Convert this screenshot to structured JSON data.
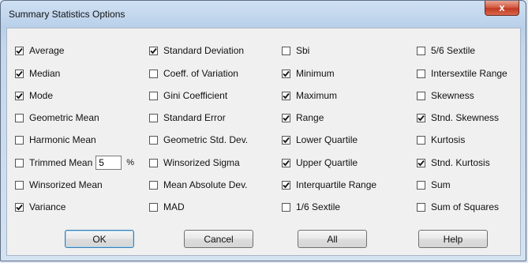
{
  "window": {
    "title": "Summary Statistics Options",
    "close_label": "x"
  },
  "options": {
    "col1": [
      {
        "label": "Average",
        "checked": true
      },
      {
        "label": "Median",
        "checked": true
      },
      {
        "label": "Mode",
        "checked": true
      },
      {
        "label": "Geometric Mean",
        "checked": false
      },
      {
        "label": "Harmonic Mean",
        "checked": false
      },
      {
        "label": "Trimmed Mean",
        "checked": false
      },
      {
        "label": "Winsorized Mean",
        "checked": false
      },
      {
        "label": "Variance",
        "checked": true
      }
    ],
    "col2": [
      {
        "label": "Standard Deviation",
        "checked": true
      },
      {
        "label": "Coeff. of Variation",
        "checked": false
      },
      {
        "label": "Gini Coefficient",
        "checked": false
      },
      {
        "label": "Standard Error",
        "checked": false
      },
      {
        "label": "Geometric Std. Dev.",
        "checked": false
      },
      {
        "label": "Winsorized Sigma",
        "checked": false
      },
      {
        "label": "Mean Absolute Dev.",
        "checked": false
      },
      {
        "label": "MAD",
        "checked": false
      }
    ],
    "col3": [
      {
        "label": "Sbi",
        "checked": false
      },
      {
        "label": "Minimum",
        "checked": true
      },
      {
        "label": "Maximum",
        "checked": true
      },
      {
        "label": "Range",
        "checked": true
      },
      {
        "label": "Lower Quartile",
        "checked": true
      },
      {
        "label": "Upper Quartile",
        "checked": true
      },
      {
        "label": "Interquartile Range",
        "checked": true
      },
      {
        "label": "1/6 Sextile",
        "checked": false
      }
    ],
    "col4": [
      {
        "label": "5/6 Sextile",
        "checked": false
      },
      {
        "label": "Intersextile Range",
        "checked": false
      },
      {
        "label": "Skewness",
        "checked": false
      },
      {
        "label": "Stnd. Skewness",
        "checked": true
      },
      {
        "label": "Kurtosis",
        "checked": false
      },
      {
        "label": "Stnd. Kurtosis",
        "checked": true
      },
      {
        "label": "Sum",
        "checked": false
      },
      {
        "label": "Sum of Squares",
        "checked": false
      }
    ]
  },
  "trimmed": {
    "value": "5",
    "unit": "%"
  },
  "buttons": {
    "ok": "OK",
    "cancel": "Cancel",
    "all": "All",
    "help": "Help"
  }
}
